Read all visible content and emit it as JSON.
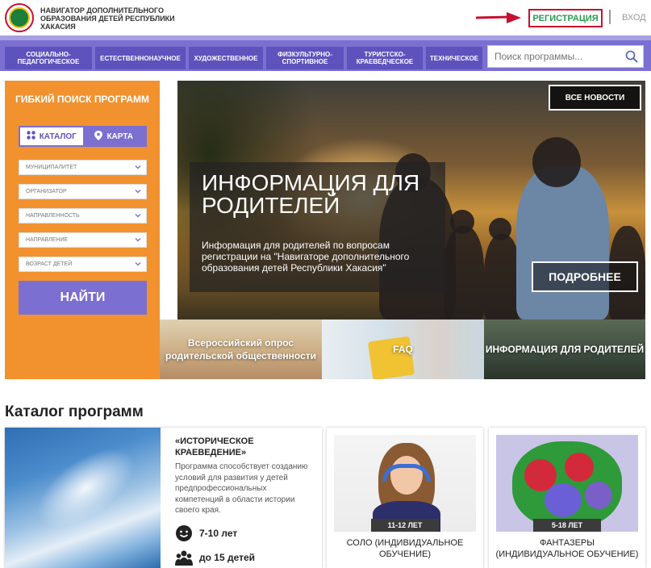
{
  "header": {
    "org_title": "НАВИГАТОР ДОПОЛНИТЕЛЬНОГО ОБРАЗОВАНИЯ ДЕТЕЙ РЕСПУБЛИКИ ХАКАСИЯ",
    "register_label": "РЕГИСТРАЦИЯ",
    "login_label": "ВХОД",
    "accent_color": "#c8102e"
  },
  "nav": {
    "items": [
      {
        "label": "СОЦИАЛЬНО-ПЕДАГОГИЧЕСКОЕ"
      },
      {
        "label": "ЕСТЕСТВЕННОНАУЧНОЕ"
      },
      {
        "label": "ХУДОЖЕСТВЕННОЕ"
      },
      {
        "label": "ФИЗКУЛЬТУРНО-СПОРТИВНОЕ"
      },
      {
        "label": "ТУРИСТСКО-КРАЕВЕДЧЕСКОЕ"
      },
      {
        "label": "ТЕХНИЧЕСКОЕ"
      }
    ],
    "search_placeholder": "Поиск программы...",
    "color": "#7b6fd1"
  },
  "sidebar": {
    "title": "ГИБКИЙ ПОИСК ПРОГРАММ",
    "toggle": {
      "catalog": "КАТАЛОГ",
      "map": "КАРТА"
    },
    "filters": [
      "МУНИЦИПАЛИТЕТ",
      "ОРГАНИЗАТОР",
      "НАПРАВЛЕННОСТЬ",
      "НАПРАВЛЕНИЕ",
      "ВОЗРАСТ ДЕТЕЙ"
    ],
    "find_label": "НАЙТИ",
    "color": "#f2922f"
  },
  "hero": {
    "title": "ИНФОРМАЦИЯ ДЛЯ РОДИТЕЛЕЙ",
    "text": "Информация для родителей по вопросам регистрации на \"Навигаторе дополнительного образования детей Республики Хакасия\"",
    "all_news_label": "ВСЕ НОВОСТИ",
    "more_label": "ПОДРОБНЕЕ"
  },
  "tiles": [
    {
      "label": "Всероссийский опрос родительской общественности"
    },
    {
      "label": "FAQ"
    },
    {
      "label": "ИНФОРМАЦИЯ ДЛЯ РОДИТЕЛЕЙ"
    }
  ],
  "catalog": {
    "title": "Каталог программ",
    "featured": {
      "title": "«ИСТОРИЧЕСКОЕ КРАЕВЕДЕНИЕ»",
      "description": "Программа способствует созданию условий для развития у детей предпрофессиональных компетенций в области истории своего края.",
      "age": "7-10 лет",
      "group": "до 15 детей"
    },
    "cards": [
      {
        "age_badge": "11-12 ЛЕТ",
        "name": "СОЛО (ИНДИВИДУАЛЬНОЕ ОБУЧЕНИЕ)"
      },
      {
        "age_badge": "5-18 ЛЕТ",
        "name": "ФАНТАЗЕРЫ (ИНДИВИДУАЛЬНОЕ ОБУЧЕНИЕ)"
      }
    ]
  }
}
